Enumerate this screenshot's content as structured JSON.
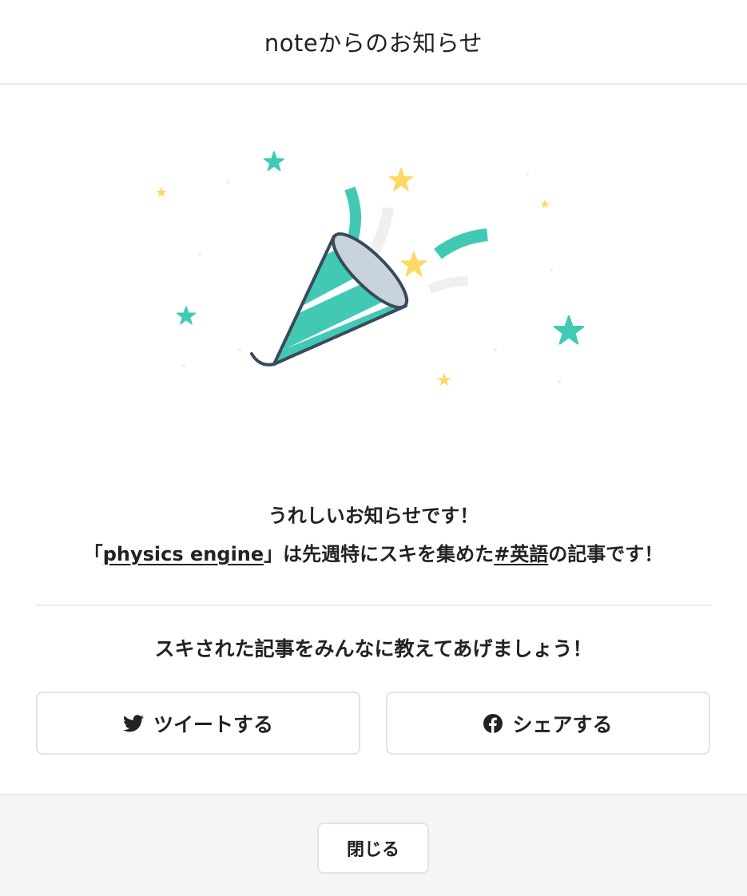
{
  "header": {
    "title": "noteからのお知らせ"
  },
  "message": {
    "line1": "うれしいお知らせです！",
    "bracket_open": "「",
    "article_title": "physics engine",
    "bracket_close": "」",
    "mid_text": "は先週特にスキを集めた",
    "hashtag": "#英語",
    "tail_text": "の記事です！"
  },
  "share": {
    "prompt": "スキされた記事をみんなに教えてあげましょう！",
    "tweet_label": "ツイートする",
    "tweet_icon": "twitter-bird-icon",
    "facebook_label": "シェアする",
    "facebook_icon": "facebook-icon"
  },
  "footer": {
    "close_label": "閉じる"
  },
  "colors": {
    "accent_teal": "#41c9b4",
    "star_yellow": "#ffd865",
    "outline_dark": "#3a4a5a",
    "border": "#e3e3e3",
    "footer_bg": "#f5f5f5"
  }
}
